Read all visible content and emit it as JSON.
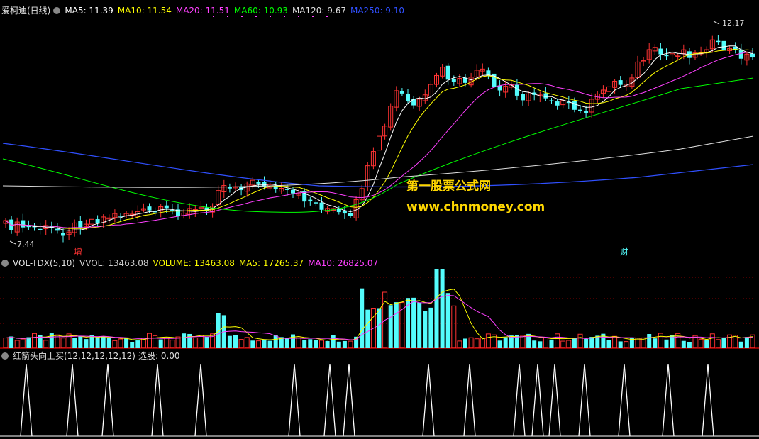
{
  "main_panel": {
    "stock_name": "爱柯迪(日线)",
    "indicators": [
      {
        "label": "MA5: 11.39",
        "color": "#ffffff"
      },
      {
        "label": "MA10: 11.54",
        "color": "#ffff00"
      },
      {
        "label": "MA20: 11.51",
        "color": "#ff40ff"
      },
      {
        "label": "MA60: 10.93",
        "color": "#00ff00"
      },
      {
        "label": "MA120: 9.67",
        "color": "#e0e0e0"
      },
      {
        "label": "MA250: 9.10",
        "color": "#3050ff"
      }
    ],
    "high_label": "12.17",
    "low_label": "7.44",
    "marker_left": "增",
    "marker_right": "财"
  },
  "watermark": {
    "line1": "第一股票公式网",
    "line2": "www.chnmoney.com"
  },
  "volume_panel": {
    "name": "VOL-TDX(5,10)",
    "items": [
      {
        "label": "VVOL: 13463.08",
        "color": "#cccccc"
      },
      {
        "label": "VOLUME: 13463.08",
        "color": "#ffff00"
      },
      {
        "label": "MA5: 17265.37",
        "color": "#ffff00"
      },
      {
        "label": "MA10: 26825.07",
        "color": "#ff40ff"
      }
    ]
  },
  "signal_panel": {
    "name": "红箭头向上买(12,12,12,12,12)",
    "value_label": "选股: 0.00"
  },
  "colors": {
    "up": "#ff3333",
    "down": "#54fcfc",
    "grid": "#8b0000"
  }
}
